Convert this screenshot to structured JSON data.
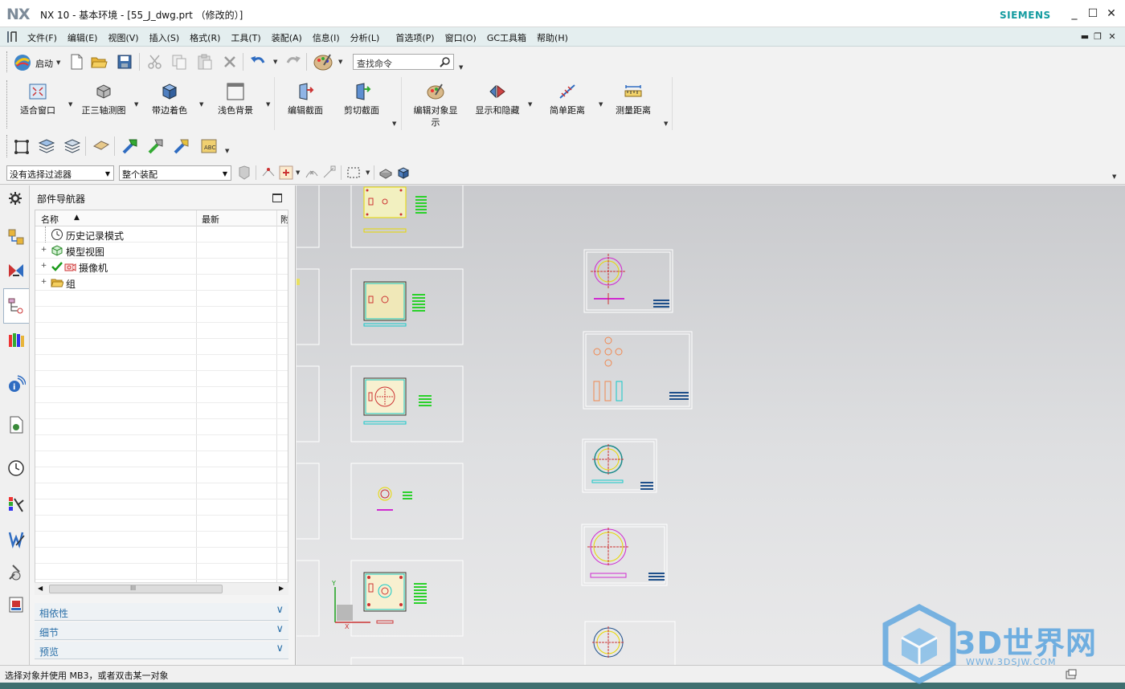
{
  "window": {
    "logo": "NX",
    "title": "NX 10 - 基本环境 - [55_J_dwg.prt （修改的）]",
    "brand": "SIEMENS",
    "minimize": "_",
    "maximize": "☐",
    "close": "✕"
  },
  "menu": {
    "items": [
      "文件(F)",
      "编辑(E)",
      "视图(V)",
      "插入(S)",
      "格式(R)",
      "工具(T)",
      "装配(A)",
      "信息(I)",
      "分析(L)",
      "首选项(P)",
      "窗口(O)",
      "GC工具箱",
      "帮助(H)"
    ]
  },
  "toolbar": {
    "start_label": "启动",
    "search_placeholder": "查找命令"
  },
  "ribbon": {
    "buttons": [
      "适合窗口",
      "正三轴测图",
      "带边着色",
      "浅色背景",
      "编辑截面",
      "剪切截面",
      "编辑对象显示",
      "显示和隐藏",
      "简单距离",
      "测量距离"
    ]
  },
  "selection": {
    "filter": "没有选择过滤器",
    "scope": "整个装配"
  },
  "navigator": {
    "title": "部件导航器",
    "columns": [
      "名称",
      "最新",
      "附"
    ],
    "sort_indicator": "▲",
    "rows": [
      {
        "label": "历史记录模式",
        "icon": "clock-icon",
        "expandable": false
      },
      {
        "label": "模型视图",
        "icon": "model-views-icon",
        "expandable": true
      },
      {
        "label": "摄像机",
        "icon": "camera-icon",
        "expandable": true
      },
      {
        "label": "组",
        "icon": "folder-icon",
        "expandable": true
      }
    ],
    "scroll_mark": "III",
    "panels": [
      "相依性",
      "细节",
      "预览"
    ]
  },
  "status": {
    "message": "选择对象并使用 MB3，或者双击某一对象"
  },
  "watermark": {
    "text": "3D世界网",
    "url": "WWW.3DSJW.COM"
  },
  "colors": {
    "accent": "#139ba0",
    "menu_bg": "#e4eeef",
    "panel_text": "#2a6fa8",
    "watermark": "#5aa4df"
  }
}
